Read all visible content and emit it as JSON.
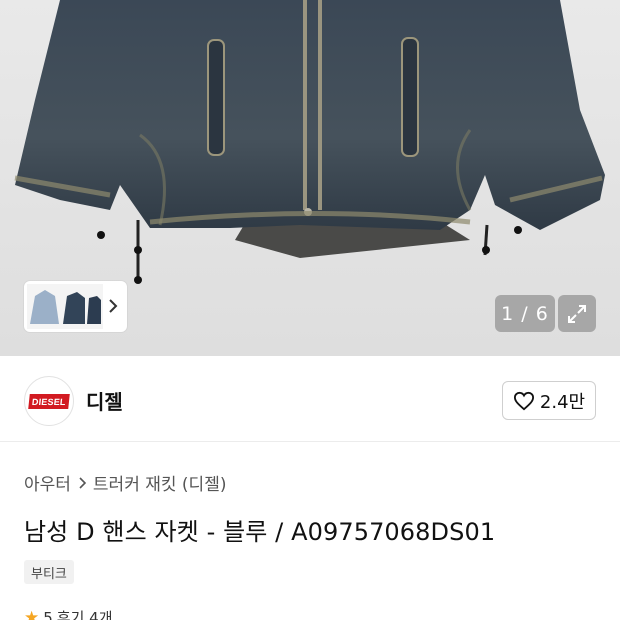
{
  "gallery": {
    "counter": "1 / 6",
    "expand_icon": "expand-icon",
    "next_icon": "chevron-right-icon"
  },
  "brand": {
    "logo_text": "DIESEL",
    "name": "디젤",
    "like_count": "2.4만",
    "like_icon": "heart-outline-icon"
  },
  "breadcrumb": {
    "parent": "아우터",
    "current": "트러커 재킷 (디젤)"
  },
  "product": {
    "title": "남성 D 핸스 자켓 - 블루 / A09757068DS01",
    "tag": "부티크"
  },
  "review": {
    "score": "5",
    "label": "후기 4개"
  },
  "colors": {
    "brand_red": "#d21a21",
    "star": "#f5a623",
    "denim": "#3a4a5a"
  }
}
